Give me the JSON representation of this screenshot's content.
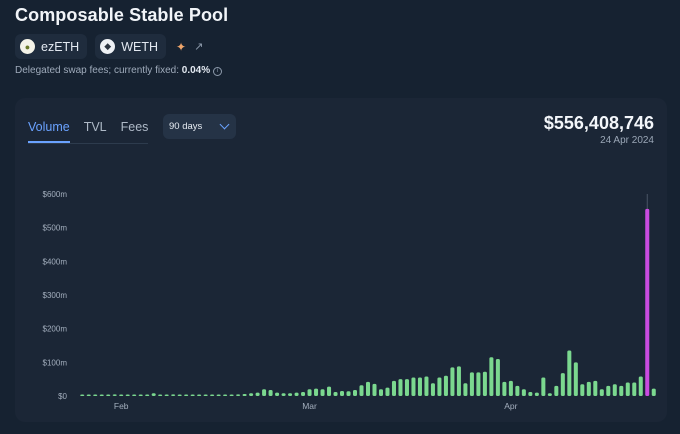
{
  "header": {
    "title": "Composable Stable Pool",
    "tokens": [
      {
        "symbol": "ezETH",
        "icon": "ezeth-icon"
      },
      {
        "symbol": "WETH",
        "icon": "ethereum-icon"
      }
    ],
    "fees_prefix": "Delegated swap fees; currently fixed: ",
    "fees_value": "0.04%"
  },
  "tabs": [
    "Volume",
    "TVL",
    "Fees"
  ],
  "range_select": "90 days",
  "summary": {
    "value": "$556,408,746",
    "date": "24 Apr 2024"
  },
  "colors": {
    "bar": "#7bd88f",
    "highlight": "#c94be0",
    "accent": "#6aa2ff"
  },
  "chart_data": {
    "type": "bar",
    "ylim": [
      0,
      600
    ],
    "yticks": [
      "$0",
      "$100m",
      "$200m",
      "$300m",
      "$400m",
      "$500m",
      "$600m"
    ],
    "xtick_labels": [
      {
        "label": "Feb",
        "index": 6
      },
      {
        "label": "Mar",
        "index": 35
      },
      {
        "label": "Apr",
        "index": 66
      }
    ],
    "unit": "millions USD",
    "values": [
      1,
      2,
      3,
      4,
      3,
      5,
      4,
      3,
      2,
      3,
      2,
      8,
      4,
      3,
      5,
      2,
      3,
      2,
      2,
      3,
      3,
      2,
      3,
      2,
      5,
      6,
      8,
      10,
      20,
      18,
      10,
      8,
      8,
      10,
      12,
      20,
      22,
      20,
      28,
      12,
      15,
      14,
      18,
      32,
      42,
      36,
      20,
      25,
      45,
      50,
      50,
      55,
      55,
      58,
      38,
      55,
      60,
      85,
      88,
      38,
      70,
      70,
      72,
      115,
      110,
      42,
      45,
      30,
      20,
      12,
      10,
      55,
      8,
      30,
      68,
      135,
      100,
      35,
      42,
      45,
      20,
      30,
      35,
      30,
      40,
      40,
      58,
      556,
      22
    ],
    "highlight_index": 87
  }
}
